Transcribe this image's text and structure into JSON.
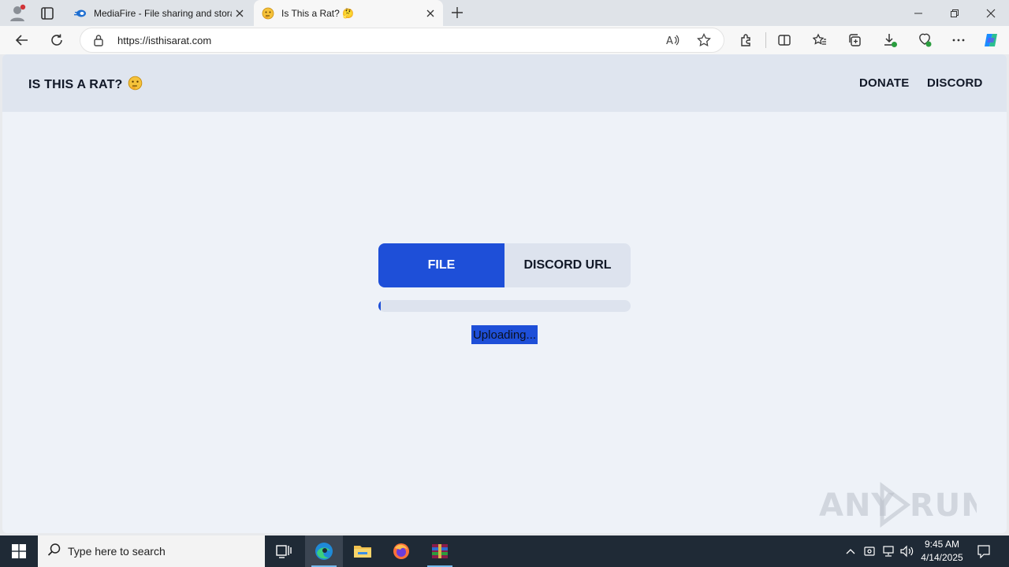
{
  "browser": {
    "tabs": [
      {
        "title": "MediaFire - File sharing and stora",
        "active": false
      },
      {
        "title": "Is This a Rat? 🤔",
        "active": true
      }
    ],
    "url": "https://isthisarat.com"
  },
  "site": {
    "brand": "IS THIS A RAT?",
    "nav": [
      "DONATE",
      "DISCORD"
    ],
    "toggle": {
      "file": "FILE",
      "discord_url": "DISCORD URL",
      "selected": "FILE"
    },
    "progress": 0.01,
    "status": "Uploading..."
  },
  "watermark": "ANY RUN",
  "taskbar": {
    "search_placeholder": "Type here to search",
    "time": "9:45 AM",
    "date": "4/14/2025"
  },
  "colors": {
    "accent": "#1e4fd8",
    "page_bg": "#eef2f8",
    "header_bg": "#dfe5ef",
    "taskbar": "#1f2a36"
  }
}
